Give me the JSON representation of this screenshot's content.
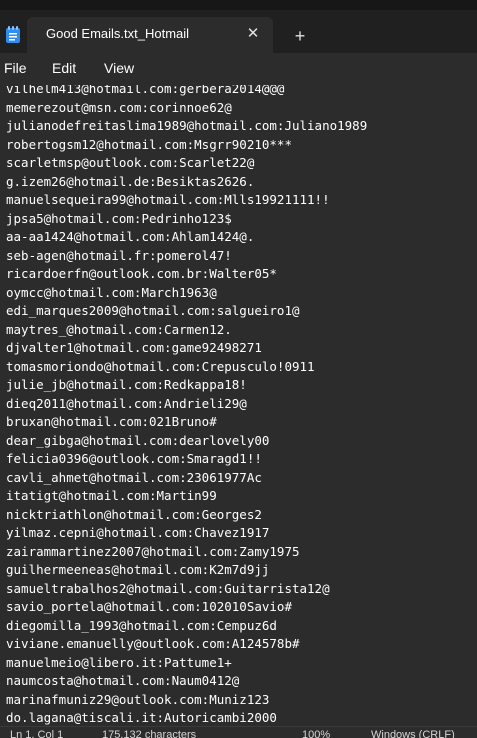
{
  "tab": {
    "title": "Good Emails.txt_Hotmail",
    "close_glyph": "✕",
    "new_tab_glyph": "+",
    "icon": "notepad-icon"
  },
  "menu": {
    "file": "File",
    "edit": "Edit",
    "view": "View"
  },
  "editor": {
    "lines": [
      "vilhelm413@hotmail.com:gerbera2014@@@",
      "memerezout@msn.com:corinnoe62@",
      "julianodefreitaslima1989@hotmail.com:Juliano1989",
      "robertogsm12@hotmail.com:Msgrr90210***",
      "scarletmsp@outlook.com:Scarlet22@",
      "g.izem26@hotmail.de:Besiktas2626.",
      "manuelsequeira99@hotmail.com:Mlls19921111!!",
      "jpsa5@hotmail.com:Pedrinho123$",
      "aa-aa1424@hotmail.com:Ahlam1424@.",
      "seb-agen@hotmail.fr:pomerol47!",
      "ricardoerfn@outlook.com.br:Walter05*",
      "oymcc@hotmail.com:March1963@",
      "edi_marques2009@hotmail.com:salgueiro1@",
      "maytres_@hotmail.com:Carmen12.",
      "djvalter1@hotmail.com:game92498271",
      "tomasmoriondo@hotmail.com:Crepusculo!0911",
      "julie_jb@hotmail.com:Redkappa18!",
      "dieq2011@hotmail.com:Andrieli29@",
      "bruxan@hotmail.com:021Bruno#",
      "dear_gibga@hotmail.com:dearlovely00",
      "felicia0396@outlook.com:Smaragd1!!",
      "cavli_ahmet@hotmail.com:23061977Ac",
      "itatigt@hotmail.com:Martin99",
      "nicktriathlon@hotmail.com:Georges2",
      "yilmaz.cepni@hotmail.com:Chavez1917",
      "zairammartinez2007@hotmail.com:Zamy1975",
      "guilhermeeneas@hotmail.com:K2m7d9jj",
      "samueltrabalhos2@hotmail.com:Guitarrista12@",
      "savio_portela@hotmail.com:102010Savio#",
      "diegomilla_1993@hotmail.com:Cempuz6d",
      "viviane.emanuelly@outlook.com:A124578b#",
      "manuelmeio@libero.it:Pattume1+",
      "naumcosta@hotmail.com:Naum0412@",
      "marinafmuniz29@outlook.com:Muniz123",
      "do.lagana@tiscali.it:Autoricambi2000"
    ]
  },
  "status": {
    "position": "Ln 1, Col 1",
    "characters": "175,132 characters",
    "zoom": "100%",
    "line_endings": "Windows (CRLF)"
  }
}
